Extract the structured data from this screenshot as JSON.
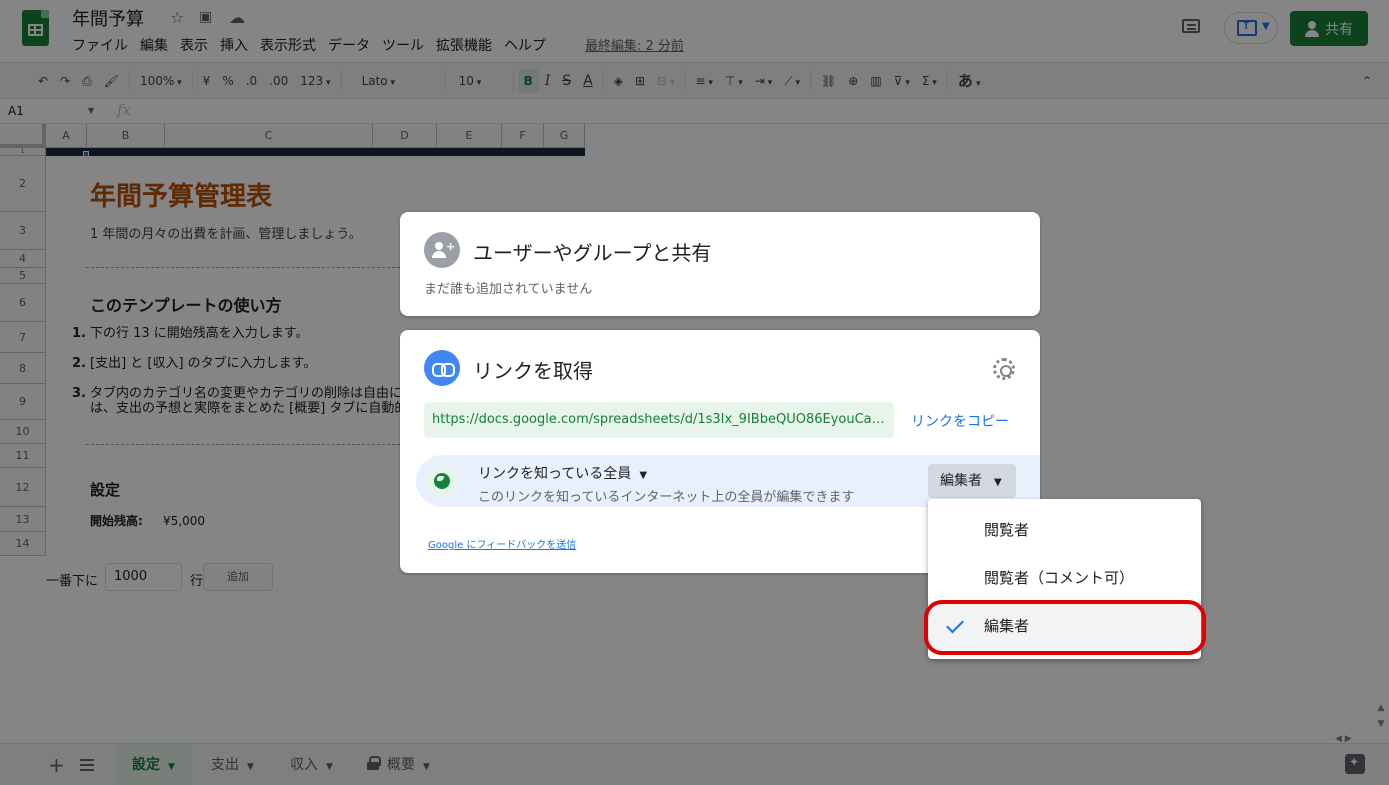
{
  "header": {
    "doc_title": "年間予算",
    "menu": [
      "ファイル",
      "編集",
      "表示",
      "挿入",
      "表示形式",
      "データ",
      "ツール",
      "拡張機能",
      "ヘルプ"
    ],
    "last_edit": "最終編集: 2 分前",
    "share_label": "共有"
  },
  "toolbar": {
    "zoom": "100%",
    "currency": "¥",
    "percent": "%",
    "dec_less": ".0",
    "dec_more": ".00",
    "number_format": "123",
    "font": "Lato",
    "font_size": "10",
    "bold": "B",
    "italic": "I",
    "strike": "S",
    "text_color": "A",
    "ime": "あ"
  },
  "formula_bar": {
    "cell_ref": "A1",
    "fx": "fx"
  },
  "grid": {
    "columns": [
      "A",
      "B",
      "C",
      "D",
      "E",
      "F",
      "G"
    ],
    "rows": [
      "1",
      "2",
      "3",
      "4",
      "5",
      "6",
      "7",
      "8",
      "9",
      "10",
      "11",
      "12",
      "13",
      "14"
    ]
  },
  "sheet": {
    "title": "年間予算管理表",
    "subtitle": "1 年間の月々の出費を計画、管理しましょう。",
    "howto_heading": "このテンプレートの使い方",
    "steps": [
      {
        "num": "1.",
        "text": "下の行 13 に開始残高を入力します。"
      },
      {
        "num": "2.",
        "text": "[支出] と [収入] のタブに入力します。"
      },
      {
        "num": "3.",
        "text": "タブ内のカテゴリ名の変更やカテゴリの削除は自由に"
      },
      {
        "num": "",
        "text": "は、支出の予想と実際をまとめた [概要] タブに自動的"
      }
    ],
    "settings_heading": "設定",
    "balance_label": "開始残高:",
    "balance_value": "¥5,000"
  },
  "add_rows": {
    "prefix": "一番下に",
    "value": "1000",
    "suffix": "行",
    "button": "追加"
  },
  "tabs": [
    "設定",
    "支出",
    "収入",
    "概要"
  ],
  "share_dialog": {
    "people_title": "ユーザーやグループと共有",
    "people_note": "まだ誰も追加されていません",
    "link_title": "リンクを取得",
    "url": "https://docs.google.com/spreadsheets/d/1s3Ix_9IBbeQUO86EyouCaq...",
    "copy_link": "リンクをコピー",
    "access_scope": "リンクを知っている全員",
    "access_desc": "このリンクを知っているインターネット上の全員が編集できます",
    "role": "編集者",
    "feedback": "Google にフィードバックを送信"
  },
  "role_menu": {
    "items": [
      "閲覧者",
      "閲覧者（コメント可）",
      "編集者"
    ],
    "selected": "編集者"
  },
  "colors": {
    "brand_green": "#188038",
    "link_blue": "#1a73e8",
    "highlight_red": "#e00000"
  }
}
